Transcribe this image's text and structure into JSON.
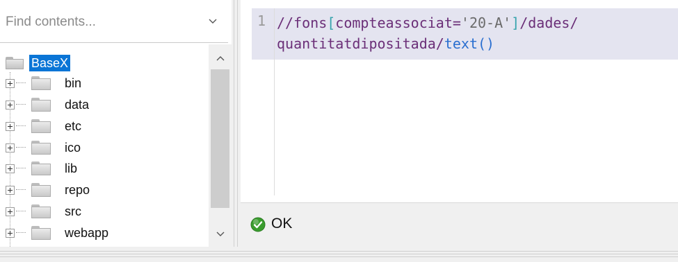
{
  "search": {
    "placeholder": "Find contents..."
  },
  "tree": {
    "root": {
      "label": "BaseX",
      "selected": true
    },
    "children": [
      {
        "label": "bin"
      },
      {
        "label": "data"
      },
      {
        "label": "etc"
      },
      {
        "label": "ico"
      },
      {
        "label": "lib"
      },
      {
        "label": "repo"
      },
      {
        "label": "src"
      },
      {
        "label": "webapp"
      }
    ]
  },
  "editor": {
    "line_number": "1",
    "code_part1": "//fons",
    "code_bracket_open": "[",
    "code_attr": "compteassociat=",
    "code_string": "'20-A'",
    "code_bracket_close": "]",
    "code_part2": "/dades/",
    "code_part3": "quantitatdipositada/",
    "code_fn": "text()"
  },
  "status": {
    "text": "OK",
    "icon": "check-circle-icon",
    "color": "#3a9d2e"
  },
  "colors": {
    "selection": "#0a75d6",
    "code_line_bg": "#e4e4f0"
  }
}
